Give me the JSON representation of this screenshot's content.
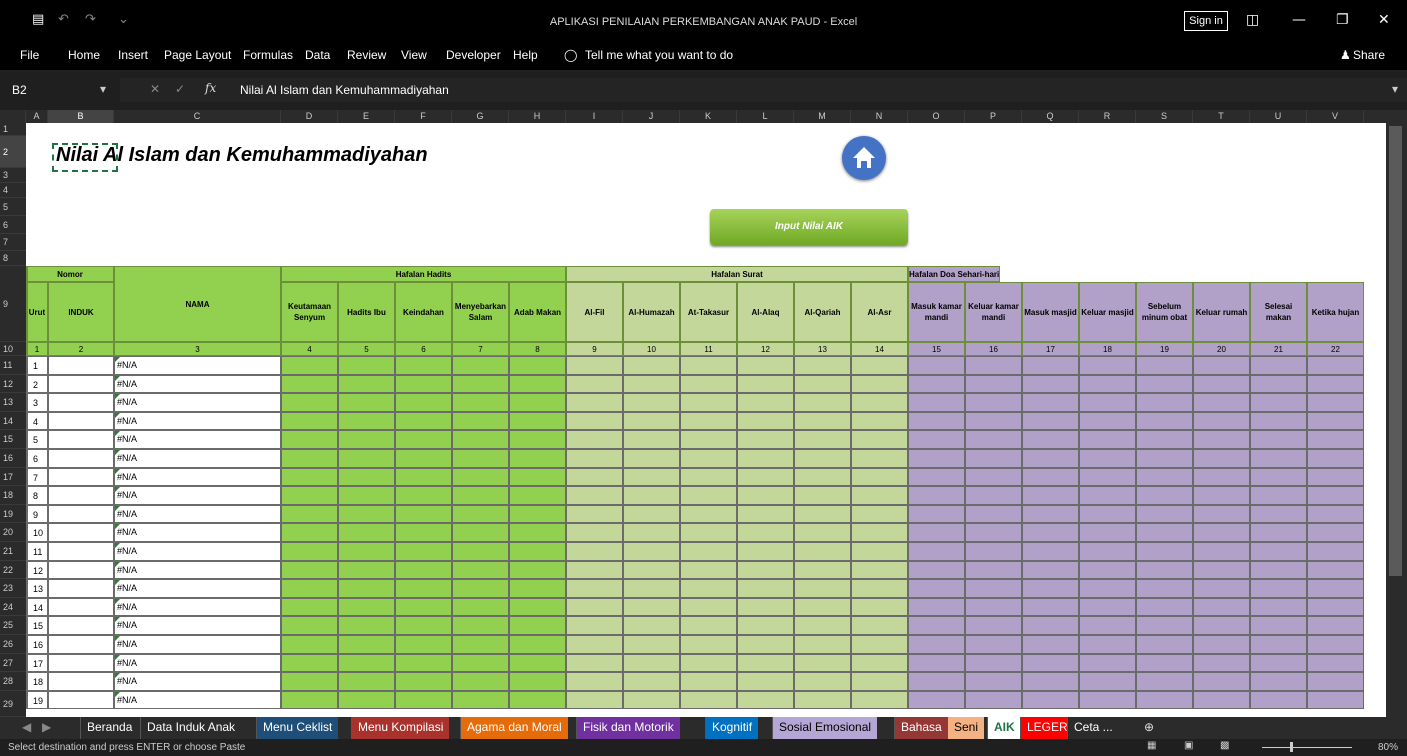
{
  "window": {
    "title": "APLIKASI PENILAIAN PERKEMBANGAN ANAK PAUD  -  Excel",
    "signin": "Sign in"
  },
  "ribbon": {
    "tabs": [
      "File",
      "Home",
      "Insert",
      "Page Layout",
      "Formulas",
      "Data",
      "Review",
      "View",
      "Developer",
      "Help"
    ],
    "tell_me": "Tell me what you want to do",
    "share": "Share"
  },
  "formula": {
    "namebox": "B2",
    "content": "Nilai Al Islam dan Kemuhammadiyahan",
    "fx": "fx"
  },
  "columns": [
    "A",
    "B",
    "C",
    "D",
    "E",
    "F",
    "G",
    "H",
    "I",
    "J",
    "K",
    "L",
    "M",
    "N",
    "O",
    "P",
    "Q",
    "R",
    "S",
    "T",
    "U",
    "V"
  ],
  "rows": [
    "1",
    "2",
    "3",
    "4",
    "5",
    "6",
    "7",
    "8",
    "9",
    "10",
    "11",
    "12",
    "13",
    "14",
    "15",
    "16",
    "17",
    "18",
    "19",
    "20",
    "21",
    "22",
    "23",
    "24",
    "25",
    "26",
    "27",
    "28",
    "29"
  ],
  "sheet": {
    "title": "Nilai Al Islam dan Kemuhammadiyahan",
    "input_button": "Input Nilai  AIK",
    "nomor": "Nomor",
    "urut": "Urut",
    "induk": "INDUK",
    "nama": "NAMA",
    "groups": [
      "Hafalan Hadits",
      "Hafalan Surat",
      "Hafalan Doa Sehari-hari"
    ],
    "subheads": [
      "Keutamaan Senyum",
      "Hadits Ibu",
      "Keindahan",
      "Menyebarkan Salam",
      "Adab Makan",
      "Al-Fil",
      "Al-Humazah",
      "At-Takasur",
      "Al-Alaq",
      "Al-Qariah",
      "Al-Asr",
      "Masuk kamar mandi",
      "Keluar kamar mandi",
      "Masuk masjid",
      "Keluar masjid",
      "Sebelum minum obat",
      "Keluar rumah",
      "Selesai makan",
      "Ketika hujan"
    ],
    "index_row": [
      "1",
      "2",
      "3",
      "4",
      "5",
      "6",
      "7",
      "8",
      "9",
      "10",
      "11",
      "12",
      "13",
      "14",
      "15",
      "16",
      "17",
      "18",
      "19",
      "20",
      "21",
      "22"
    ],
    "urut_values": [
      "1",
      "2",
      "3",
      "4",
      "5",
      "6",
      "7",
      "8",
      "9",
      "10",
      "11",
      "12",
      "13",
      "14",
      "15",
      "16",
      "17",
      "18",
      "19"
    ],
    "nama_value": "#N/A"
  },
  "tabs": [
    "Beranda",
    "Data Induk Anak",
    "Menu Ceklist",
    "Menu Kompilasi",
    "Agama dan Moral",
    "Fisik dan Motorik",
    "Kognitif",
    "Sosial Emosional",
    "Bahasa",
    "Seni",
    "AIK",
    "LEGER",
    "Ceta ..."
  ],
  "tab_colors": [
    "#2b2b2b",
    "#2b2b2b",
    "#1f4e79",
    "#a9322c",
    "#e46c0a",
    "#7030a0",
    "#0070c0",
    "#b4a7d6",
    "#953734",
    "#f4b183",
    "#ffffff",
    "#ff0000",
    "#2b2b2b"
  ],
  "status": {
    "message": "Select destination and press ENTER or choose Paste",
    "zoom": "80%"
  }
}
